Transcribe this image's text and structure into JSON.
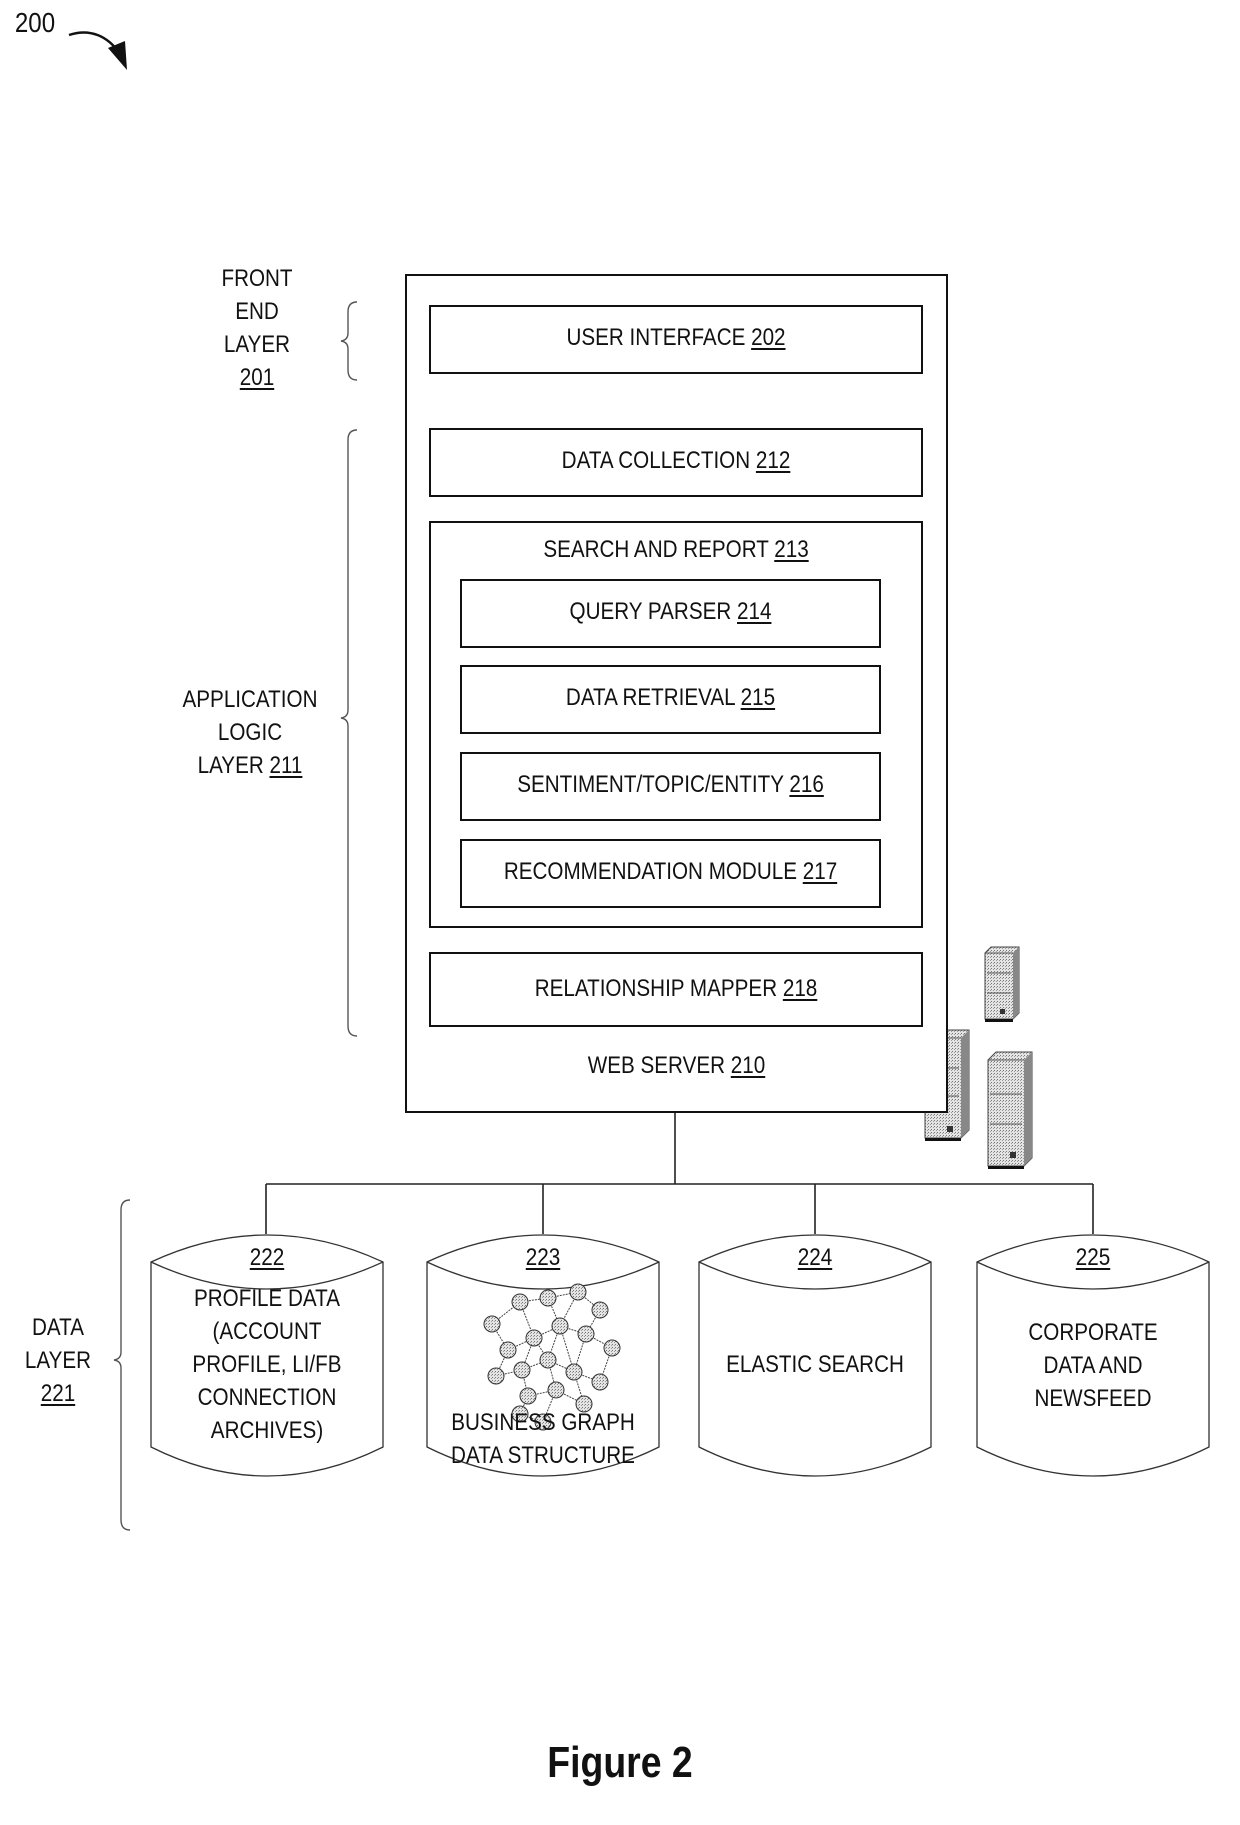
{
  "figure": {
    "ref_number": "200",
    "caption": "Figure 2"
  },
  "layers": {
    "front_end": {
      "lines": [
        "FRONT",
        "END",
        "LAYER"
      ],
      "ref": "201"
    },
    "application_logic": {
      "lines": [
        "APPLICATION",
        "LOGIC",
        "LAYER"
      ],
      "ref": "211"
    },
    "data": {
      "lines": [
        "DATA",
        "LAYER"
      ],
      "ref": "221"
    }
  },
  "web_server": {
    "label": "WEB SERVER",
    "ref": "210",
    "icon": "server-tower-icon",
    "modules": {
      "user_interface": {
        "label": "USER INTERFACE",
        "ref": "202"
      },
      "data_collection": {
        "label": "DATA COLLECTION",
        "ref": "212"
      },
      "search_and_report": {
        "label": "SEARCH AND REPORT",
        "ref": "213",
        "submodules": [
          {
            "label": "QUERY PARSER",
            "ref": "214"
          },
          {
            "label": "DATA RETRIEVAL",
            "ref": "215"
          },
          {
            "label": "SENTIMENT/TOPIC/ENTITY",
            "ref": "216"
          },
          {
            "label": "RECOMMENDATION MODULE",
            "ref": "217"
          }
        ]
      },
      "relationship_mapper": {
        "label": "RELATIONSHIP MAPPER",
        "ref": "218"
      }
    }
  },
  "databases": [
    {
      "ref": "222",
      "lines": [
        "PROFILE DATA",
        "(ACCOUNT",
        "PROFILE, LI/FB",
        "CONNECTION",
        "ARCHIVES)"
      ]
    },
    {
      "ref": "223",
      "lines": [
        "BUSINESS GRAPH",
        "DATA STRUCTURE"
      ],
      "icon": "network-graph-icon"
    },
    {
      "ref": "224",
      "lines": [
        "ELASTIC SEARCH"
      ]
    },
    {
      "ref": "225",
      "lines": [
        "CORPORATE",
        "DATA AND",
        "NEWSFEED"
      ]
    }
  ]
}
